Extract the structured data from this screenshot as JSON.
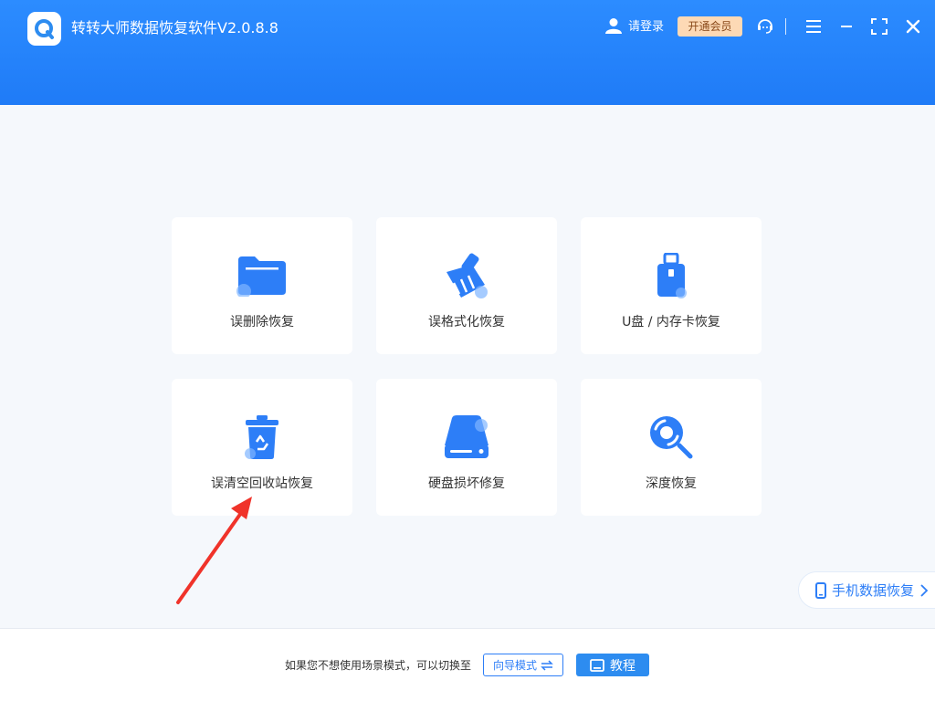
{
  "window": {
    "title": "转转大师数据恢复软件V2.0.8.8",
    "login_label": "请登录",
    "vip_label": "开通会员"
  },
  "cards": [
    {
      "label": "误删除恢复",
      "icon": "folder-icon"
    },
    {
      "label": "误格式化恢复",
      "icon": "broom-icon"
    },
    {
      "label": "U盘 / 内存卡恢复",
      "icon": "usb-drive-icon"
    },
    {
      "label": "误清空回收站恢复",
      "icon": "recycle-bin-icon"
    },
    {
      "label": "硬盘损坏修复",
      "icon": "hard-disk-icon"
    },
    {
      "label": "深度恢复",
      "icon": "deep-search-icon"
    }
  ],
  "mobile_tab": {
    "label": "手机数据恢复"
  },
  "footer": {
    "hint": "如果您不想使用场景模式，可以切换至",
    "guide_label": "向导模式",
    "tutorial_label": "教程"
  },
  "colors": {
    "primary": "#2d7ef7",
    "header": "#2c8cff",
    "vip_bg": "#fdd9b5",
    "annotation": "#f0332a"
  }
}
